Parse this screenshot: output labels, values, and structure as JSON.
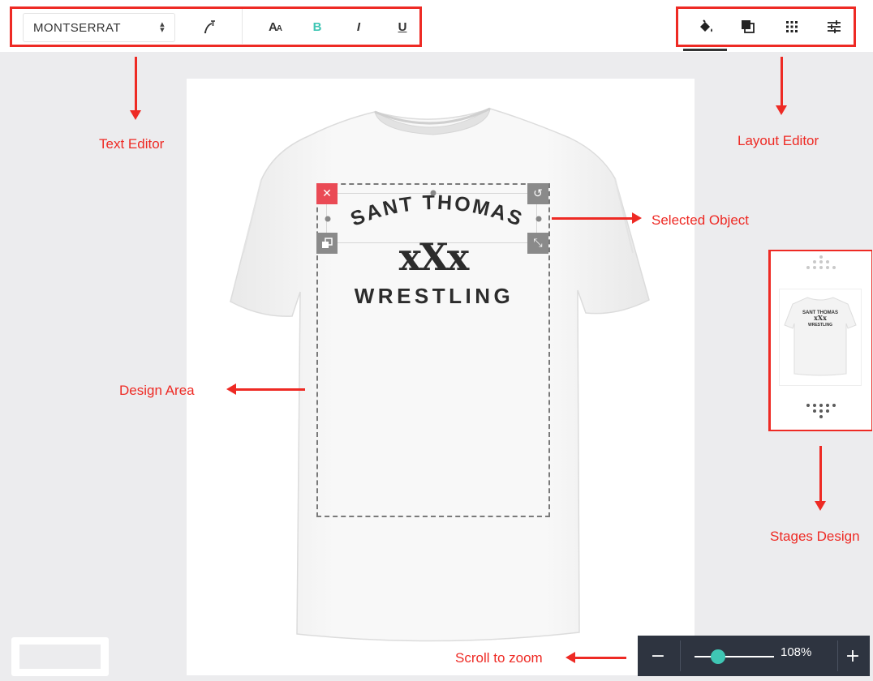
{
  "toolbar": {
    "font_name": "MONTSERRAT",
    "font_size_label": "AA",
    "bold_label": "B",
    "italic_label": "I",
    "underline_label": "U"
  },
  "design": {
    "line1": "SANT THOMAS",
    "line2": "xXx",
    "line3": "WRESTLING"
  },
  "annotations": {
    "text_editor": "Text Editor",
    "layout_editor": "Layout Editor",
    "selected_object": "Selected Object",
    "design_area": "Design Area",
    "stages_design": "Stages Design",
    "scroll_to_zoom": "Scroll to zoom"
  },
  "zoom": {
    "level_text": "108%",
    "level_fraction": 0.3,
    "minus": "−",
    "plus": "+"
  },
  "stage_thumb": {
    "line1": "SANT THOMAS",
    "line2": "xXx",
    "line3": "WRESTLING"
  },
  "colors": {
    "annotation": "#ee2a24",
    "accent": "#3fc6b4",
    "delete_handle": "#ea4a55",
    "zoom_bar": "#2e3440"
  },
  "icons": {
    "curved_text": "curved-text-icon",
    "fill": "paint-bucket-icon",
    "layers": "layers-icon",
    "grid": "grid-icon",
    "settings": "sliders-icon"
  }
}
